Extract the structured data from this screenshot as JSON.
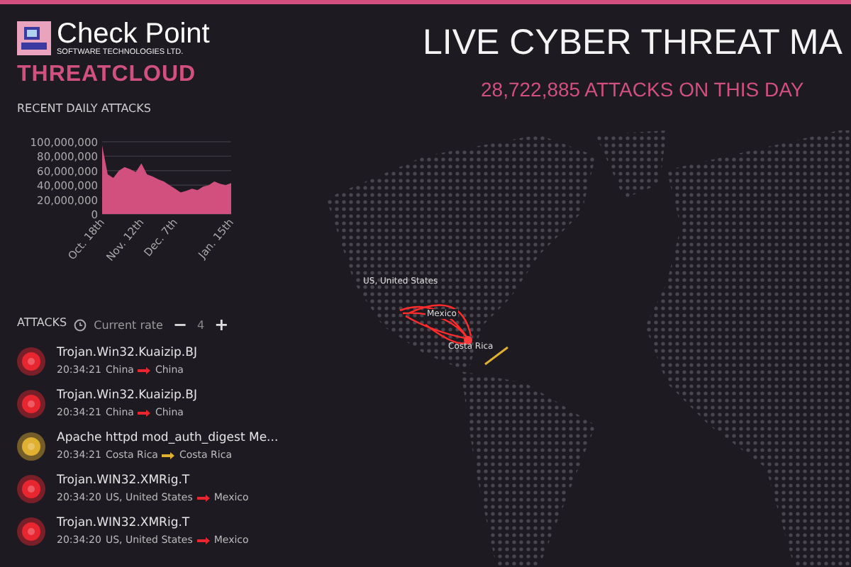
{
  "brand": {
    "name": "Check Point",
    "tagline": "SOFTWARE TECHNOLOGIES LTD.",
    "product": "THREATCLOUD"
  },
  "title": "LIVE CYBER THREAT MA",
  "subtitle": "28,722,885 ATTACKS ON THIS DAY",
  "daily": {
    "heading": "RECENT DAILY ATTACKS",
    "chart_data": {
      "type": "area",
      "categories": [
        "Oct. 18th",
        null,
        null,
        null,
        null,
        null,
        null,
        "Nov. 12th",
        null,
        null,
        null,
        null,
        null,
        "Dec. 7th",
        null,
        null,
        null,
        null,
        null,
        null,
        null,
        null,
        null,
        "Jan. 15th"
      ],
      "series": [
        {
          "color": "#d2507e",
          "values": [
            95000000,
            55000000,
            50000000,
            60000000,
            65000000,
            62000000,
            58000000,
            70000000,
            55000000,
            52000000,
            48000000,
            45000000,
            40000000,
            35000000,
            30000000,
            32000000,
            35000000,
            33000000,
            38000000,
            40000000,
            45000000,
            42000000,
            40000000,
            43000000
          ]
        }
      ],
      "ylim": [
        0,
        100000000
      ],
      "grid": true,
      "yticks": [
        {
          "value": 0,
          "label": "0"
        },
        {
          "value": 20000000,
          "label": "20,000,000"
        },
        {
          "value": 40000000,
          "label": "40,000,000"
        },
        {
          "value": 60000000,
          "label": "60,000,000"
        },
        {
          "value": 80000000,
          "label": "80,000,000"
        },
        {
          "value": 100000000,
          "label": "100,000,000"
        }
      ]
    }
  },
  "attacks": {
    "heading": "ATTACKS",
    "rate_label": "Current rate",
    "minus": "−",
    "rate": "4",
    "plus": "+",
    "items": [
      {
        "name": "Trojan.Win32.Kuaizip.BJ",
        "time": "20:34:21",
        "from": "China",
        "to": "China",
        "color": "#e8262f"
      },
      {
        "name": "Trojan.Win32.Kuaizip.BJ",
        "time": "20:34:21",
        "from": "China",
        "to": "China",
        "color": "#e8262f"
      },
      {
        "name": "Apache httpd mod_auth_digest Me...",
        "time": "20:34:21",
        "from": "Costa Rica",
        "to": "Costa Rica",
        "color": "#e0b030"
      },
      {
        "name": "Trojan.WIN32.XMRig.T",
        "time": "20:34:20",
        "from": "US, United States",
        "to": "Mexico",
        "color": "#e8262f"
      },
      {
        "name": "Trojan.WIN32.XMRig.T",
        "time": "20:34:20",
        "from": "US, United States",
        "to": "Mexico",
        "color": "#e8262f"
      }
    ]
  },
  "map_labels": [
    "US, United States",
    "Mexico",
    "Costa Rica"
  ]
}
